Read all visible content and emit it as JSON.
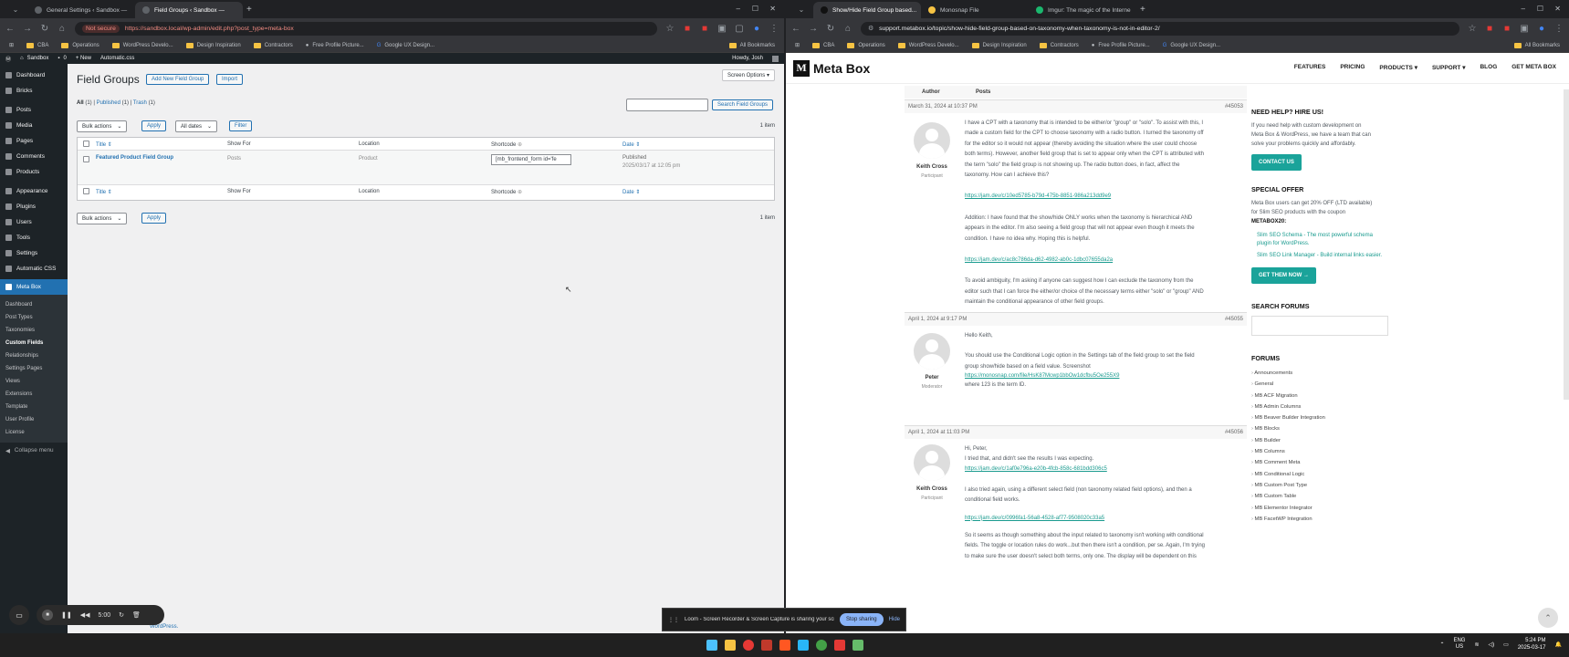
{
  "left": {
    "tabs": [
      {
        "title": "General Settings ‹ Sandbox —"
      },
      {
        "title": "Field Groups ‹ Sandbox —"
      }
    ],
    "security": "Not secure",
    "url": "https://sandbox.local/wp-admin/edit.php?post_type=meta-box",
    "bookmarks": [
      "CBA",
      "Operations",
      "WordPress Develo...",
      "Design Inspiration",
      "Contractors",
      "Free Profile Picture...",
      "Google UX Design..."
    ],
    "all_bookmarks": "All Bookmarks",
    "adminbar": {
      "site": "Sandbox",
      "comments": "0",
      "new": "+ New",
      "plugin": "Automatic.css",
      "howdy": "Howdy, Josh"
    },
    "menu": [
      "Dashboard",
      "Bricks",
      "Posts",
      "Media",
      "Pages",
      "Comments",
      "Products",
      "Appearance",
      "Plugins",
      "Users",
      "Tools",
      "Settings",
      "Automatic CSS"
    ],
    "menu_current": "Meta Box",
    "submenu": [
      "Dashboard",
      "Post Types",
      "Taxonomies",
      "Custom Fields",
      "Relationships",
      "Settings Pages",
      "Views",
      "Extensions",
      "Template",
      "User Profile",
      "License"
    ],
    "collapse": "Collapse menu",
    "screen_options": "Screen Options ▾",
    "page_title": "Field Groups",
    "add_new": "Add New Field Group",
    "import": "Import",
    "filters": {
      "all": "All",
      "all_count": "(1)",
      "published": "Published",
      "published_count": "(1)",
      "trash": "Trash",
      "trash_count": "(1)"
    },
    "search_btn": "Search Field Groups",
    "bulk": "Bulk actions",
    "apply": "Apply",
    "dates": "All dates",
    "filter": "Filter",
    "count": "1 item",
    "columns": [
      "Title",
      "Show For",
      "Location",
      "Shortcode",
      "Date"
    ],
    "row": {
      "title": "Featured Product Field Group",
      "show_for": "Posts",
      "location": "Product",
      "shortcode": "[mb_frontend_form id='fe",
      "status": "Published",
      "date": "2025/03/17 at 12:05 pm"
    },
    "recorder_time": "5:00",
    "footer_link": "WordPress."
  },
  "right": {
    "tabs": [
      {
        "title": "Show/Hide Field Group based..."
      },
      {
        "title": "Monosnap File"
      },
      {
        "title": "Imgur: The magic of the Interne"
      }
    ],
    "url": "support.metabox.io/topic/show-hide-field-group-based-on-taxonomy-when-taxonomy-is-not-in-editor-2/",
    "brand": "Meta Box",
    "nav": [
      "FEATURES",
      "PRICING",
      "PRODUCTS ▾",
      "SUPPORT ▾",
      "BLOG",
      "GET META BOX"
    ],
    "head_author": "Author",
    "head_posts": "Posts",
    "posts": [
      {
        "date": "March 31, 2024 at 10:37 PM",
        "id": "#45053",
        "user": "Keith Cross",
        "role": "Participant",
        "lines": [
          "I have a CPT with a taxonomy that is intended to be either/or \"group\" or \"solo\". To assist with this, I",
          "made a custom field for the CPT to choose taxonomy with a radio button. I turned the taxonomy off",
          "for the editor so it would not appear (thereby avoiding the situation where the user could choose",
          "both terms). However, another field group that is set to appear only when the CPT is attributed with",
          "the term \"solo\" the field group is not showing up. The radio button does, in fact, affect the",
          "taxonomy. How can I achieve this?"
        ],
        "link1": "https://jam.dev/c/10ed5785-b79d-475b-8851-986a213dd9e9",
        "lines2": [
          "Addition: I have found that the show/hide ONLY works when the taxonomy is hierarchical AND",
          "appears in the editor. I'm also seeing a field group that will not appear even though it meets the",
          "condition. I have no idea why. Hoping this is helpful."
        ],
        "link2": "https://jam.dev/c/ac8c786da-d62-4982-ab0c-1dbc07655da2a",
        "lines3": [
          "To avoid ambiguity, I'm asking if anyone can suggest how I can exclude the taxonomy from the",
          "editor such that I can force the either/or choice of the necessary terms either \"solo\" or \"group\" AND",
          "maintain the conditional appearance of other field groups."
        ]
      },
      {
        "date": "April 1, 2024 at 9:17 PM",
        "id": "#45055",
        "user": "Peter",
        "role": "Moderator",
        "lines": [
          "Hello Keith,",
          "",
          "You should use the Conditional Logic option in the Settings tab of the field group to set the field",
          "group show/hide based on a field value. Screenshot"
        ],
        "link1": "https://monosnap.com/file/HsK87Mcwp1bbOw1dcfbu5Oe255X9",
        "lines2": [
          "where 123 is the term ID."
        ]
      },
      {
        "date": "April 1, 2024 at 11:03 PM",
        "id": "#45056",
        "user": "Keith Cross",
        "role": "Participant",
        "lines": [
          "Hi, Peter,",
          "I tried that, and didn't see the results I was expecting."
        ],
        "link1": "https://jam.dev/c/1af0e796a-e20b-4fcb-858c-681bdd306c5",
        "lines2": [
          "I also tried again, using a different select field (non taxonomy related field options), and then a",
          "conditional field works."
        ],
        "link2": "https://jam.dev/c/0996fa1-56a8-4528-af77-9508020c33a5",
        "lines3": [
          "So it seems as though something about the input related to taxonomy isn't working with conditional",
          "fields. The toggle or location rules do work...but then there isn't a condition, per se. Again, I'm trying",
          "to make sure the user doesn't select both terms, only one. The display will be dependent on this"
        ]
      }
    ],
    "sidebar": {
      "hire_title": "NEED HELP? HIRE US!",
      "hire_text": [
        "If you need help with custom development on",
        "Meta Box & WordPress, we have a team that can",
        "solve your problems quickly and affordably."
      ],
      "contact": "CONTACT US",
      "offer_title": "SPECIAL OFFER",
      "offer_text": [
        "Meta Box users can get 20% OFF (LTD available)",
        "for Slim SEO products with the coupon",
        "METABOX20:"
      ],
      "offer_items": [
        "Slim SEO Schema - The most powerful schema plugin for WordPress.",
        "Slim SEO Link Manager - Build internal links easier."
      ],
      "get_now": "GET THEM NOW →",
      "search_title": "SEARCH FORUMS",
      "forums_title": "FORUMS",
      "forums": [
        "Announcements",
        "General",
        "MB ACF Migration",
        "MB Admin Columns",
        "MB Beaver Builder Integration",
        "MB Blocks",
        "MB Builder",
        "MB Columns",
        "MB Comment Meta",
        "MB Conditional Logic",
        "MB Custom Post Type",
        "MB Custom Table",
        "MB Elementor Integrator",
        "MB FacetWP Integration"
      ]
    },
    "share_text": "Loom - Screen Recorder & Screen Capture is sharing your screen.",
    "stop_sharing": "Stop sharing",
    "hide": "Hide"
  },
  "tray": {
    "lang": "ENG",
    "region": "US",
    "time": "5:24 PM",
    "date": "2025-03-17"
  },
  "colors": {
    "wp_blue": "#2271b1",
    "wp_dark": "#1d2327",
    "teal": "#1aa39a"
  }
}
